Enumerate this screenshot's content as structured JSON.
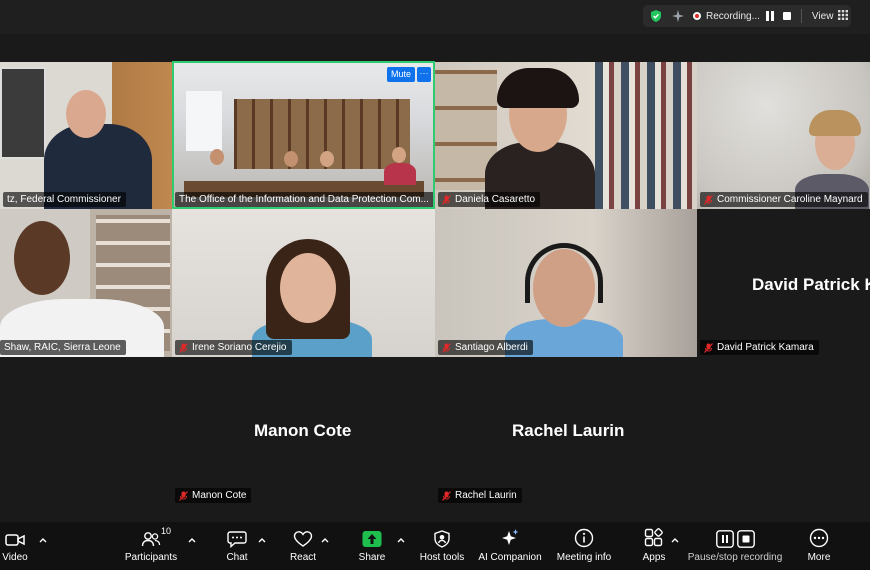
{
  "topbar": {
    "recording_label": "Recording...",
    "view_label": "View"
  },
  "tiles": [
    {
      "name": "tz, Federal Commissioner"
    },
    {
      "name": "The Office of the Information and Data Protection Com...",
      "mute_label": "Mute",
      "more_label": "···"
    },
    {
      "name": "Daniela Casaretto"
    },
    {
      "name": "Commissioner Caroline Maynard"
    },
    {
      "name": "Shaw, RAIC, Sierra Leone"
    },
    {
      "name": "Irene Soriano Cerejio"
    },
    {
      "name": "Santiago Alberdi"
    },
    {
      "name": "David Patrick Kamara",
      "big_name": "David Patrick K"
    },
    {
      "name": "Manon Cote",
      "big_name": "Manon Cote"
    },
    {
      "name": "Rachel Laurin",
      "big_name": "Rachel Laurin"
    }
  ],
  "toolbar": {
    "video": "Video",
    "participants": "Participants",
    "participants_count": "10",
    "chat": "Chat",
    "react": "React",
    "share": "Share",
    "host_tools": "Host tools",
    "ai_companion": "AI Companion",
    "meeting_info": "Meeting info",
    "apps": "Apps",
    "pause_stop_recording": "Pause/stop recording",
    "more": "More"
  },
  "colors": {
    "active_speaker_border": "#2ecc71",
    "share_green": "#1fbf4f",
    "mute_blue": "#0e72ed",
    "recording_red": "#e02828"
  }
}
